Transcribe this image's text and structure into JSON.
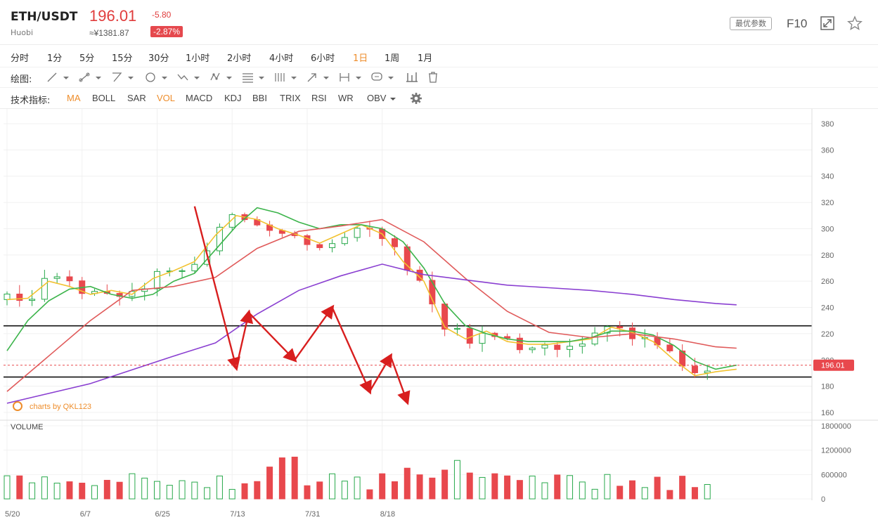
{
  "header": {
    "symbol": "ETH/USDT",
    "exchange": "Huobi",
    "price": "196.01",
    "price_cny": "≈¥1381.87",
    "change": "-5.80",
    "change_pct": "-2.87%",
    "best_params_label": "最优参数",
    "f10_label": "F10",
    "icons": [
      "fullscreen-icon",
      "star-icon"
    ]
  },
  "periods": {
    "items": [
      "分时",
      "1分",
      "5分",
      "15分",
      "30分",
      "1小时",
      "2小时",
      "4小时",
      "6小时",
      "1日",
      "1周",
      "1月"
    ],
    "active": "1日"
  },
  "drawing": {
    "label": "绘图:",
    "tools": [
      "line-tool-icon",
      "segment-tool-icon",
      "ray-tool-icon",
      "shape-tool-icon",
      "wave-tool-icon",
      "pattern-tool-icon",
      "fib-tool-icon",
      "channel-tool-icon",
      "arrow-tool-icon",
      "measure-tool-icon",
      "note-tool-icon",
      "bars-tool-icon",
      "trash-icon"
    ]
  },
  "indicators": {
    "label": "技术指标:",
    "items": [
      "MA",
      "BOLL",
      "SAR",
      "VOL",
      "MACD",
      "KDJ",
      "BBI",
      "TRIX",
      "RSI",
      "WR",
      "OBV"
    ],
    "active": [
      "MA",
      "VOL"
    ],
    "settings_icon": "gear-icon"
  },
  "colors": {
    "up": "#28a94b",
    "down": "#e8484d",
    "ma5": "#f2c230",
    "ma10": "#3cb44b",
    "ma30": "#e05a5a",
    "ma60": "#8a3fd1",
    "annotation": "#d81e1e"
  },
  "chart_data": {
    "type": "candlestick",
    "interval": "1日",
    "watermark": "charts by QKL123",
    "price_axis": {
      "ticks": [
        380,
        360,
        340,
        320,
        300,
        280,
        260,
        240,
        220,
        200,
        180,
        160
      ],
      "range": [
        160,
        380
      ]
    },
    "current_price_label": "196.01",
    "current_price": 196.01,
    "x_tick_labels": [
      "5/20",
      "6/7",
      "6/25",
      "7/13",
      "7/31",
      "8/18"
    ],
    "volume_panel": {
      "label": "VOLUME",
      "ticks": [
        "1800000",
        "1200000",
        "600000",
        "0"
      ],
      "range": [
        0,
        1800000
      ]
    },
    "support_resistance_lines": [
      226,
      187
    ],
    "annotation_zigzag": [
      {
        "date": "7/4",
        "price": 317
      },
      {
        "date": "7/14",
        "price": 194
      },
      {
        "date": "7/17",
        "price": 236
      },
      {
        "date": "7/28",
        "price": 200
      },
      {
        "date": "8/6",
        "price": 240
      },
      {
        "date": "8/15",
        "price": 176
      },
      {
        "date": "8/20",
        "price": 203
      },
      {
        "date": "8/24",
        "price": 168
      }
    ],
    "series": [
      {
        "name": "MA5",
        "color": "#f2c230",
        "values": [
          [
            0,
            246
          ],
          [
            5,
            247
          ],
          [
            10,
            260
          ],
          [
            15,
            256
          ],
          [
            20,
            250
          ],
          [
            25,
            253
          ],
          [
            30,
            250
          ],
          [
            35,
            262
          ],
          [
            40,
            268
          ],
          [
            45,
            275
          ],
          [
            50,
            295
          ],
          [
            55,
            310
          ],
          [
            60,
            307
          ],
          [
            65,
            300
          ],
          [
            70,
            295
          ],
          [
            75,
            289
          ],
          [
            80,
            296
          ],
          [
            85,
            303
          ],
          [
            90,
            296
          ],
          [
            95,
            275
          ],
          [
            100,
            260
          ],
          [
            105,
            225
          ],
          [
            110,
            216
          ],
          [
            115,
            222
          ],
          [
            120,
            214
          ],
          [
            125,
            212
          ],
          [
            130,
            212
          ],
          [
            135,
            214
          ],
          [
            140,
            216
          ],
          [
            145,
            225
          ],
          [
            150,
            221
          ],
          [
            155,
            214
          ],
          [
            160,
            200
          ],
          [
            165,
            188
          ],
          [
            170,
            191
          ],
          [
            175,
            193
          ]
        ]
      },
      {
        "name": "MA10",
        "color": "#3cb44b",
        "values": [
          [
            0,
            207
          ],
          [
            5,
            230
          ],
          [
            10,
            245
          ],
          [
            15,
            254
          ],
          [
            20,
            256
          ],
          [
            25,
            250
          ],
          [
            30,
            247
          ],
          [
            35,
            250
          ],
          [
            40,
            260
          ],
          [
            45,
            266
          ],
          [
            50,
            284
          ],
          [
            55,
            302
          ],
          [
            60,
            316
          ],
          [
            65,
            312
          ],
          [
            70,
            305
          ],
          [
            75,
            300
          ],
          [
            80,
            303
          ],
          [
            85,
            303
          ],
          [
            90,
            300
          ],
          [
            95,
            290
          ],
          [
            100,
            270
          ],
          [
            105,
            243
          ],
          [
            110,
            226
          ],
          [
            115,
            220
          ],
          [
            120,
            216
          ],
          [
            125,
            214
          ],
          [
            130,
            214
          ],
          [
            135,
            214
          ],
          [
            140,
            217
          ],
          [
            145,
            222
          ],
          [
            150,
            222
          ],
          [
            155,
            219
          ],
          [
            160,
            211
          ],
          [
            165,
            199
          ],
          [
            170,
            193
          ],
          [
            175,
            196
          ]
        ]
      },
      {
        "name": "MA30",
        "color": "#e05a5a",
        "values": [
          [
            0,
            176
          ],
          [
            10,
            203
          ],
          [
            20,
            230
          ],
          [
            30,
            253
          ],
          [
            40,
            256
          ],
          [
            50,
            263
          ],
          [
            60,
            285
          ],
          [
            70,
            298
          ],
          [
            80,
            302
          ],
          [
            90,
            307
          ],
          [
            100,
            290
          ],
          [
            110,
            262
          ],
          [
            120,
            237
          ],
          [
            130,
            221
          ],
          [
            140,
            217
          ],
          [
            150,
            220
          ],
          [
            160,
            216
          ],
          [
            170,
            210
          ],
          [
            175,
            209
          ]
        ]
      },
      {
        "name": "MA60",
        "color": "#8a3fd1",
        "values": [
          [
            0,
            167
          ],
          [
            20,
            182
          ],
          [
            40,
            203
          ],
          [
            50,
            213
          ],
          [
            60,
            235
          ],
          [
            70,
            253
          ],
          [
            80,
            264
          ],
          [
            90,
            273
          ],
          [
            100,
            265
          ],
          [
            110,
            261
          ],
          [
            120,
            257
          ],
          [
            130,
            255
          ],
          [
            140,
            253
          ],
          [
            150,
            250
          ],
          [
            160,
            246
          ],
          [
            170,
            243
          ],
          [
            175,
            242
          ]
        ]
      }
    ]
  }
}
